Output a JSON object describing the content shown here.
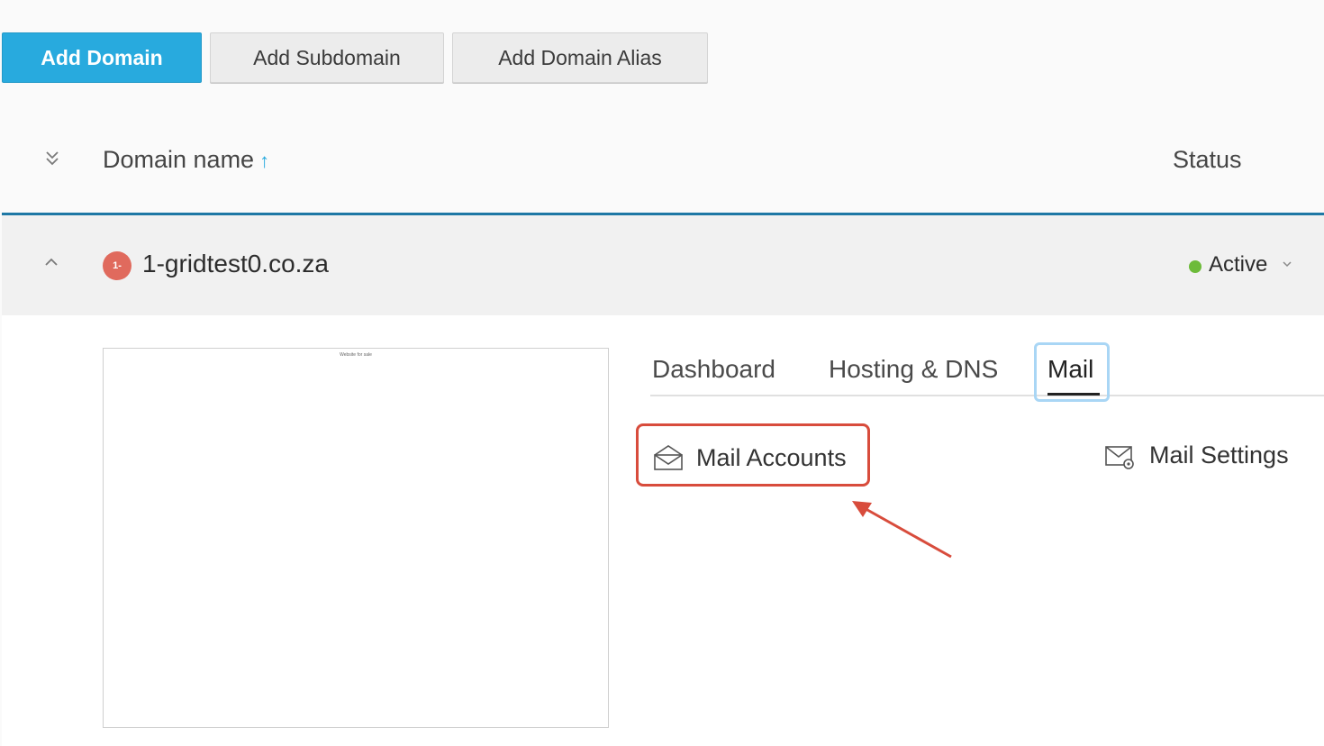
{
  "toolbar": {
    "add_domain": "Add Domain",
    "add_subdomain": "Add Subdomain",
    "add_domain_alias": "Add Domain Alias"
  },
  "list_header": {
    "domain_name": "Domain name",
    "sort_icon": "arrow-up-icon",
    "status": "Status"
  },
  "domain": {
    "favicon_text": "1-",
    "favicon_color": "#e06a5d",
    "name": "1-gridtest0.co.za",
    "status": "Active",
    "status_color": "#6dbb3a",
    "preview_caption": "Website for sale"
  },
  "tabs": [
    {
      "label": "Dashboard"
    },
    {
      "label": "Hosting & DNS"
    },
    {
      "label": "Mail",
      "active": true
    }
  ],
  "mail_links": {
    "accounts": "Mail Accounts",
    "settings": "Mail Settings"
  },
  "colors": {
    "primary": "#28aade",
    "highlight": "#d84c3c",
    "divider": "#1e78a5"
  }
}
